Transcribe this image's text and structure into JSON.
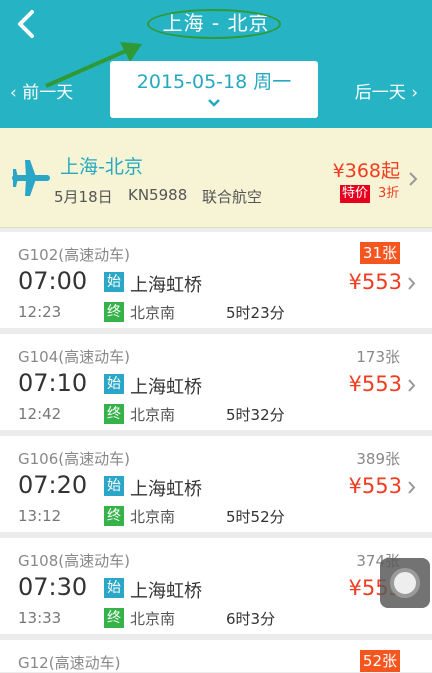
{
  "header": {
    "title": "上海 - 北京",
    "prev_day": "前一天",
    "next_day": "后一天",
    "date": "2015-05-18 周一"
  },
  "flight": {
    "route": "上海-北京",
    "date": "5月18日",
    "number": "KN5988",
    "airline": "联合航空",
    "price": "¥368起",
    "special": "特价",
    "discount": "3折"
  },
  "trains": [
    {
      "code": "G102(高速动车)",
      "depart": "07:00",
      "arrive": "12:23",
      "start_badge": "始",
      "end_badge": "终",
      "from": "上海虹桥",
      "to": "北京南",
      "duration": "5时23分",
      "seats": "31张",
      "price": "¥553"
    },
    {
      "code": "G104(高速动车)",
      "depart": "07:10",
      "arrive": "12:42",
      "start_badge": "始",
      "end_badge": "终",
      "from": "上海虹桥",
      "to": "北京南",
      "duration": "5时32分",
      "seats": "173张",
      "price": "¥553"
    },
    {
      "code": "G106(高速动车)",
      "depart": "07:20",
      "arrive": "13:12",
      "start_badge": "始",
      "end_badge": "终",
      "from": "上海虹桥",
      "to": "北京南",
      "duration": "5时52分",
      "seats": "389张",
      "price": "¥553"
    },
    {
      "code": "G108(高速动车)",
      "depart": "07:30",
      "arrive": "13:33",
      "start_badge": "始",
      "end_badge": "终",
      "from": "上海虹桥",
      "to": "北京南",
      "duration": "6时3分",
      "seats": "374张",
      "price": "¥553"
    },
    {
      "code": "G12(高速动车)",
      "seats": "52张"
    }
  ],
  "colors": {
    "header": "#26b3c4",
    "price": "#f03c20",
    "annotation": "#2f9a35"
  }
}
